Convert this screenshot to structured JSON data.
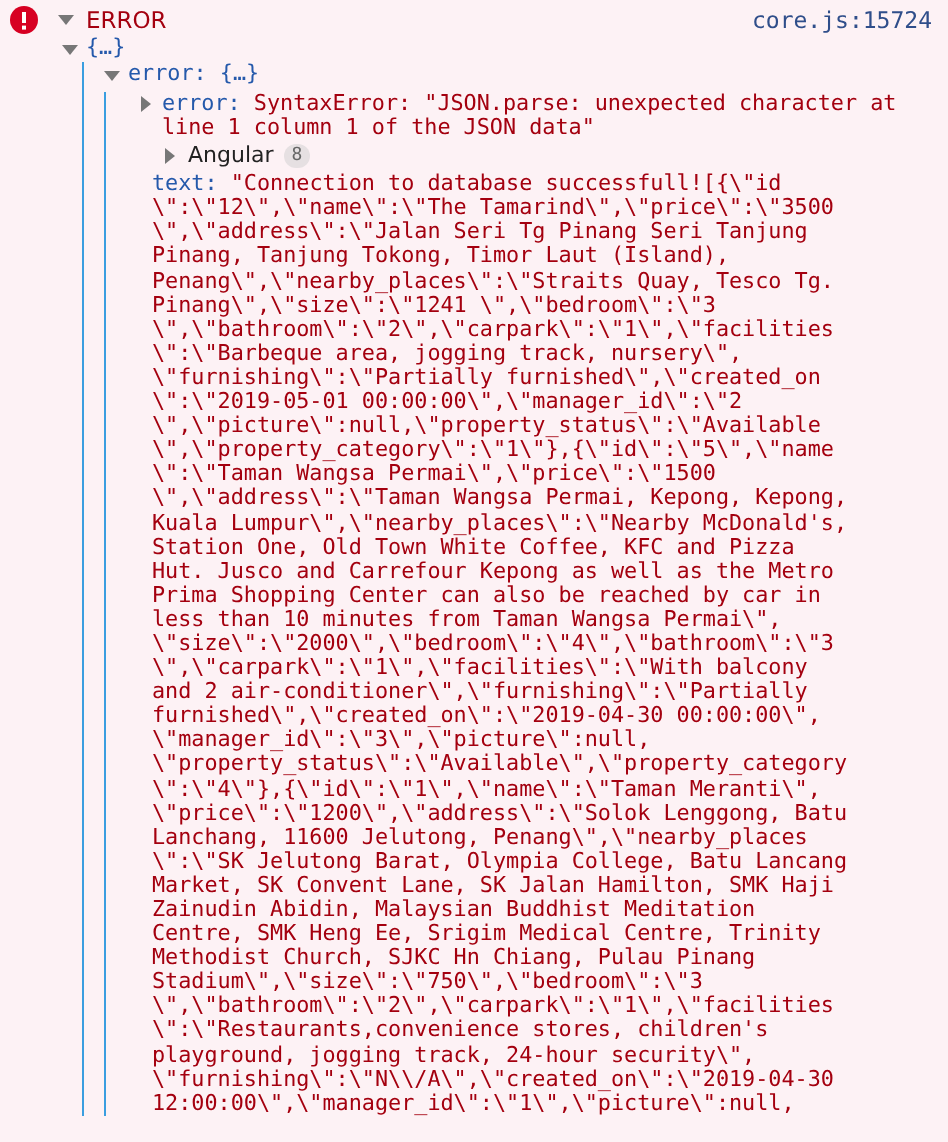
{
  "log": {
    "label": "ERROR",
    "source": "core.js:15724",
    "expanded": true,
    "root": {
      "value": "{…}",
      "expanded": true,
      "children": [
        {
          "kind": "object",
          "key": "error:",
          "value": "{…}",
          "expanded": true,
          "children": [
            {
              "kind": "error",
              "key": "error:",
              "value": "SyntaxError: \"JSON.parse: unexpected character at line 1 column 1 of the JSON data\"",
              "expanded": false
            },
            {
              "kind": "group",
              "key": "Angular",
              "badge": "8",
              "expanded": false
            },
            {
              "kind": "string",
              "key": "text:",
              "value": "\"Connection to database successfull![{\\\"id\n\\\":\\\"12\\\",\\\"name\\\":\\\"The Tamarind\\\",\\\"price\\\":\\\"3500\n\\\",\\\"address\\\":\\\"Jalan Seri Tg Pinang Seri Tanjung\nPinang, Tanjung Tokong, Timor Laut (Island),\nPenang\\\",\\\"nearby_places\\\":\\\"Straits Quay, Tesco Tg.\nPinang\\\",\\\"size\\\":\\\"1241 \\\",\\\"bedroom\\\":\\\"3\n\\\",\\\"bathroom\\\":\\\"2\\\",\\\"carpark\\\":\\\"1\\\",\\\"facilities\n\\\":\\\"Barbeque area, jogging track, nursery\\\",\n\\\"furnishing\\\":\\\"Partially furnished\\\",\\\"created_on\n\\\":\\\"2019-05-01 00:00:00\\\",\\\"manager_id\\\":\\\"2\n\\\",\\\"picture\\\":null,\\\"property_status\\\":\\\"Available\n\\\",\\\"property_category\\\":\\\"1\\\"},{\\\"id\\\":\\\"5\\\",\\\"name\n\\\":\\\"Taman Wangsa Permai\\\",\\\"price\\\":\\\"1500\n\\\",\\\"address\\\":\\\"Taman Wangsa Permai, Kepong, Kepong,\nKuala Lumpur\\\",\\\"nearby_places\\\":\\\"Nearby McDonald's,\nStation One, Old Town White Coffee, KFC and Pizza\nHut. Jusco and Carrefour Kepong as well as the Metro\nPrima Shopping Center can also be reached by car in\nless than 10 minutes from Taman Wangsa Permai\\\",\n\\\"size\\\":\\\"2000\\\",\\\"bedroom\\\":\\\"4\\\",\\\"bathroom\\\":\\\"3\n\\\",\\\"carpark\\\":\\\"1\\\",\\\"facilities\\\":\\\"With balcony\nand 2 air-conditioner\\\",\\\"furnishing\\\":\\\"Partially\nfurnished\\\",\\\"created_on\\\":\\\"2019-04-30 00:00:00\\\",\n\\\"manager_id\\\":\\\"3\\\",\\\"picture\\\":null,\n\\\"property_status\\\":\\\"Available\\\",\\\"property_category\n\\\":\\\"4\\\"},{\\\"id\\\":\\\"1\\\",\\\"name\\\":\\\"Taman Meranti\\\",\n\\\"price\\\":\\\"1200\\\",\\\"address\\\":\\\"Solok Lenggong, Batu\nLanchang, 11600 Jelutong, Penang\\\",\\\"nearby_places\n\\\":\\\"SK Jelutong Barat, Olympia College, Batu Lancang\nMarket, SK Convent Lane, SK Jalan Hamilton, SMK Haji\nZainudin Abidin, Malaysian Buddhist Meditation\nCentre, SMK Heng Ee, Srigim Medical Centre, Trinity\nMethodist Church, SJKC Hn Chiang, Pulau Pinang\nStadium\\\",\\\"size\\\":\\\"750\\\",\\\"bedroom\\\":\\\"3\n\\\",\\\"bathroom\\\":\\\"2\\\",\\\"carpark\\\":\\\"1\\\",\\\"facilities\n\\\":\\\"Restaurants,convenience stores, children's\nplayground, jogging track, 24-hour security\\\",\n\\\"furnishing\\\":\\\"N\\\\/A\\\",\\\"created_on\\\":\\\"2019-04-30\n12:00:00\\\",\\\"manager_id\\\":\\\"1\\\",\\\"picture\\\":null,"
            }
          ]
        }
      ]
    }
  }
}
